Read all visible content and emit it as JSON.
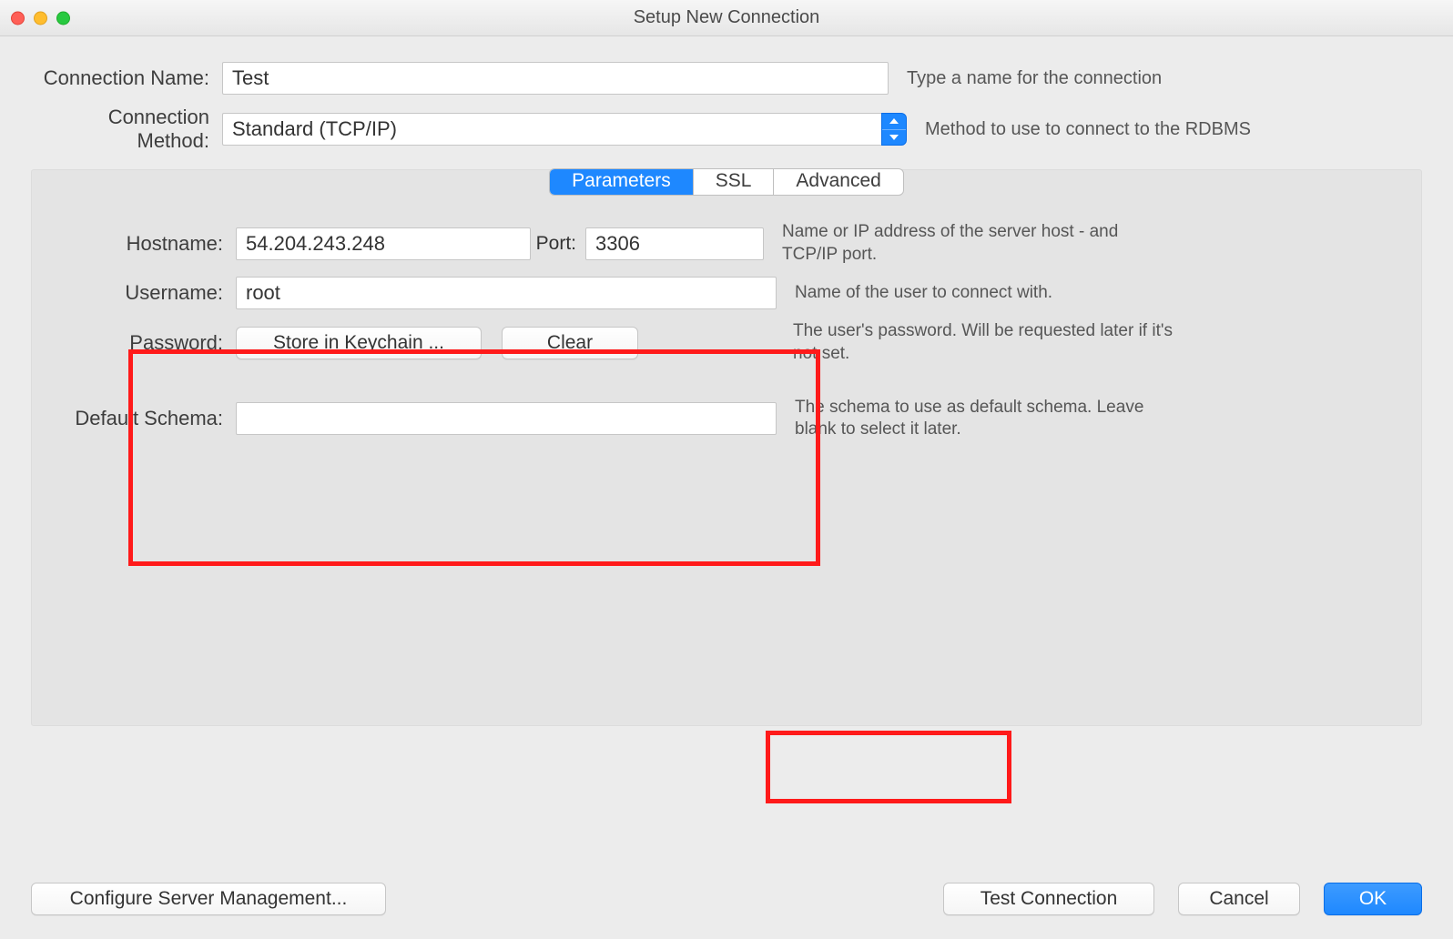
{
  "window": {
    "title": "Setup New Connection"
  },
  "top": {
    "connection_name_label": "Connection Name:",
    "connection_name_value": "Test",
    "connection_name_help": "Type a name for the connection",
    "connection_method_label": "Connection Method:",
    "connection_method_value": "Standard (TCP/IP)",
    "connection_method_help": "Method to use to connect to the RDBMS"
  },
  "tabs": {
    "parameters": "Parameters",
    "ssl": "SSL",
    "advanced": "Advanced"
  },
  "params": {
    "hostname_label": "Hostname:",
    "hostname_value": "54.204.243.248",
    "port_label": "Port:",
    "port_value": "3306",
    "host_help": "Name or IP address of the server host - and TCP/IP port.",
    "username_label": "Username:",
    "username_value": "root",
    "username_help": "Name of the user to connect with.",
    "password_label": "Password:",
    "store_keychain_label": "Store in Keychain ...",
    "clear_label": "Clear",
    "password_help": "The user's password. Will be requested later if it's not set.",
    "schema_label": "Default Schema:",
    "schema_value": "",
    "schema_help": "The schema to use as default schema. Leave blank to select it later."
  },
  "footer": {
    "configure": "Configure Server Management...",
    "test": "Test Connection",
    "cancel": "Cancel",
    "ok": "OK"
  }
}
